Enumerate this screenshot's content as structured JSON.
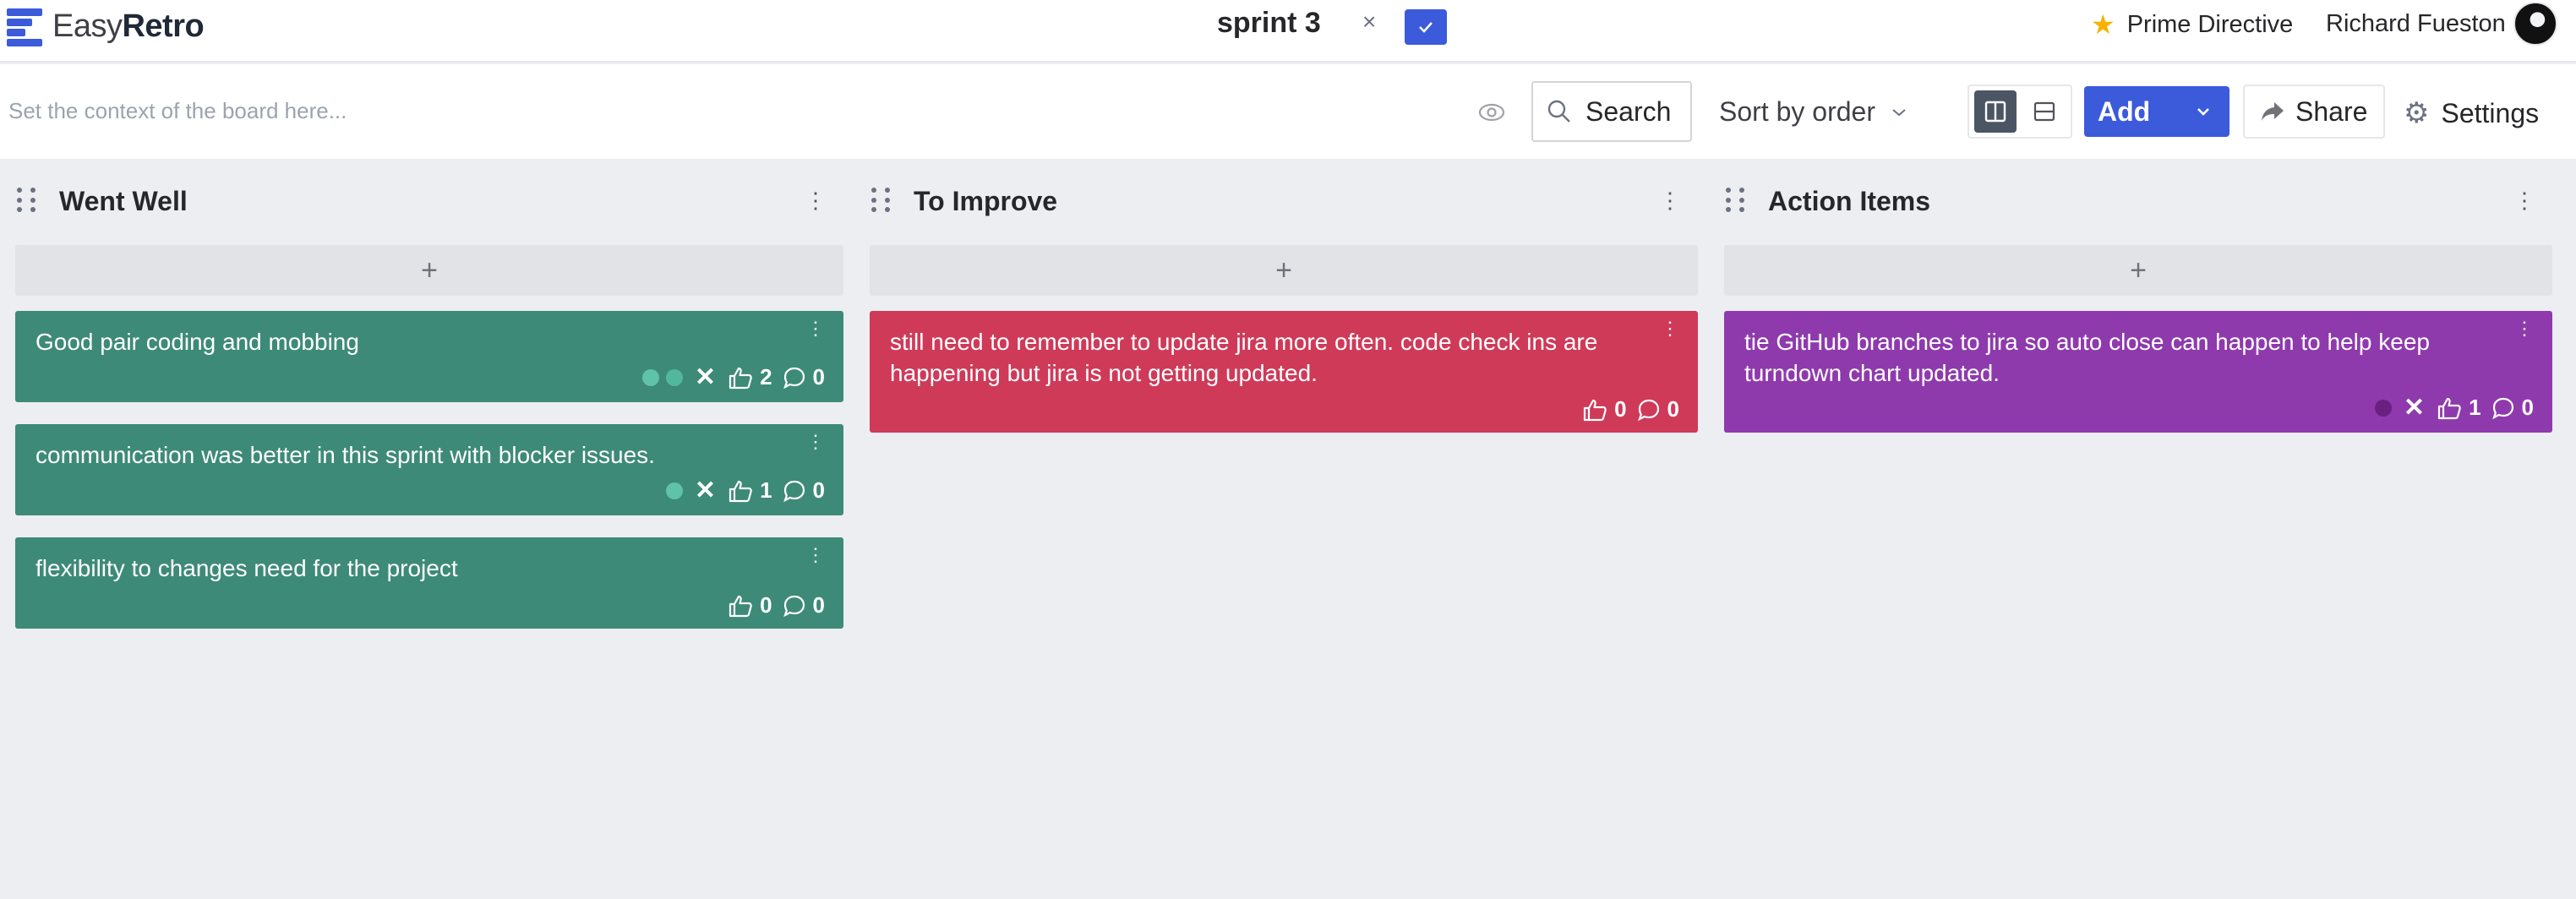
{
  "app": {
    "brand_light": "Easy",
    "brand_bold": "Retro"
  },
  "board": {
    "title": "sprint 3",
    "close_glyph": "×",
    "confirm_glyph": "✓"
  },
  "header": {
    "prime_directive": "Prime Directive",
    "user_name": "Richard Fueston"
  },
  "toolbar": {
    "context_placeholder": "Set the context of the board here...",
    "search_label": "Search",
    "sort_label": "Sort by order",
    "add_label": "Add",
    "share_label": "Share",
    "settings_label": "Settings"
  },
  "colors": {
    "accent": "#3b5bdb",
    "went_well": "#3d8a78",
    "to_improve": "#cf3a59",
    "action_items": "#8e3aad"
  },
  "columns": [
    {
      "title": "Went Well",
      "add_glyph": "+",
      "cards": [
        {
          "text": "Good pair coding and mobbing",
          "likes": "2",
          "comments": "0"
        },
        {
          "text": "communication was better in this sprint with blocker issues.",
          "likes": "1",
          "comments": "0"
        },
        {
          "text": "flexibility to changes need for the project",
          "likes": "0",
          "comments": "0"
        }
      ]
    },
    {
      "title": "To Improve",
      "add_glyph": "+",
      "cards": [
        {
          "text": "still need to remember to update jira more often. code check ins are happening but jira is not getting updated.",
          "likes": "0",
          "comments": "0"
        }
      ]
    },
    {
      "title": "Action Items",
      "add_glyph": "+",
      "cards": [
        {
          "text": "tie GitHub branches to jira so auto close can happen to help keep turndown chart updated.",
          "likes": "1",
          "comments": "0"
        }
      ]
    }
  ],
  "icons": [
    "logo-icon",
    "close-icon",
    "check-icon",
    "star-icon",
    "avatar",
    "eye-icon",
    "search-icon",
    "chevron-down-icon",
    "columns-layout-icon",
    "rows-layout-icon",
    "share-icon",
    "gear-icon",
    "drag-handle-icon",
    "more-vertical-icon",
    "plus-icon",
    "thumbs-up-icon",
    "comment-icon",
    "x-icon"
  ]
}
